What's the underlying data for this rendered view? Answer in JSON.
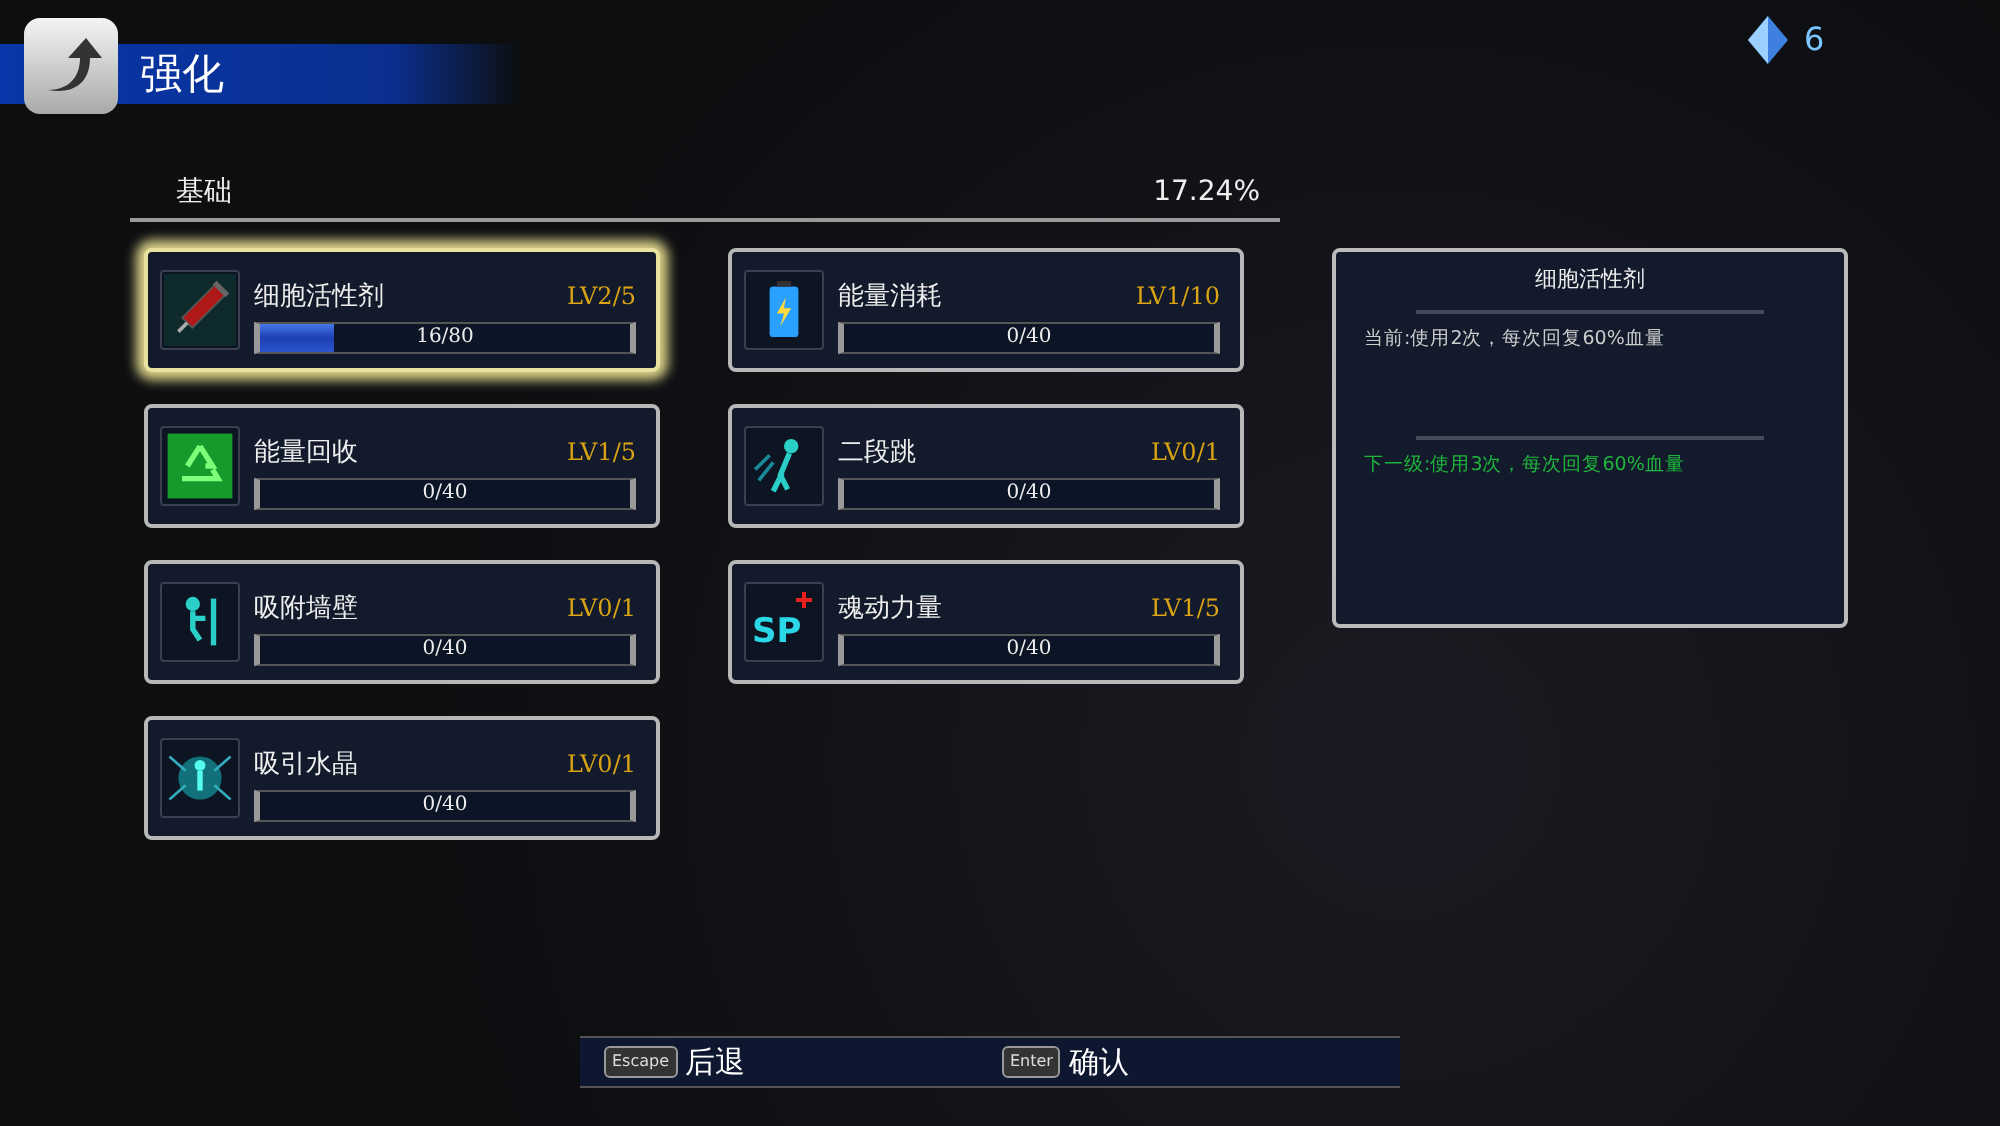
{
  "header": {
    "title": "强化"
  },
  "currency": {
    "amount": "6"
  },
  "section": {
    "title": "基础",
    "percent": "17.24%"
  },
  "skill_columns": [
    [
      {
        "name": "细胞活性剂",
        "level_text": "LV2/5",
        "progress": "16/80",
        "level": 0.2,
        "selected": true
      },
      {
        "name": "能量回收",
        "level_text": "LV1/5",
        "progress": "0/40",
        "level": 0,
        "selected": false
      },
      {
        "name": "吸附墙壁",
        "level_text": "LV0/1",
        "progress": "0/40",
        "level": 0,
        "selected": false
      },
      {
        "name": "吸引水晶",
        "level_text": "LV0/1",
        "progress": "0/40",
        "level": 0,
        "selected": false
      }
    ],
    [
      {
        "name": "能量消耗",
        "level_text": "LV1/10",
        "progress": "0/40",
        "level": 0,
        "selected": false
      },
      {
        "name": "二段跳",
        "level_text": "LV0/1",
        "progress": "0/40",
        "level": 0,
        "selected": false
      },
      {
        "name": "魂动力量",
        "icon_text": "SP",
        "level_text": "LV1/5",
        "progress": "0/40",
        "level": 0,
        "selected": false
      }
    ]
  ],
  "detail": {
    "title": "细胞活性剂",
    "current": "当前:使用2次，每次回复60%血量",
    "next": "下一级:使用3次，每次回复60%血量"
  },
  "footer": [
    {
      "key": "Escape",
      "label": "后退"
    },
    {
      "key": "Enter",
      "label": "确认"
    }
  ]
}
